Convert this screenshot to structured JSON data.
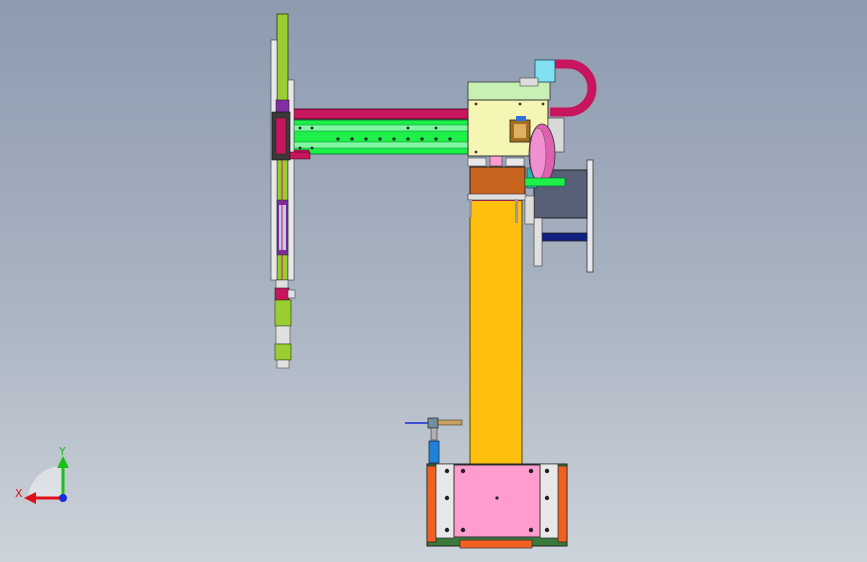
{
  "viewport": {
    "background_top": "#8d9bb0",
    "background_bottom": "#cdd3da"
  },
  "triad": {
    "x_label": "X",
    "y_label": "Y",
    "x_color": "#e0101a",
    "y_color": "#18c018",
    "z_color": "#1a2ad8"
  },
  "model": {
    "column_color": "#ffbf0f",
    "base_plate_color": "#ff9ccf",
    "base_side_color": "#f06020",
    "base_frame_color": "#3c7a3c",
    "beam_color": "#c8165e",
    "rail_color": "#1ef04a",
    "carriage_color": "#f5f5b4",
    "vertical_arm_color": "#9acd32",
    "joint_color": "#c8641e",
    "motor_color": "#586078",
    "cable_chain_color": "#c8165e"
  }
}
